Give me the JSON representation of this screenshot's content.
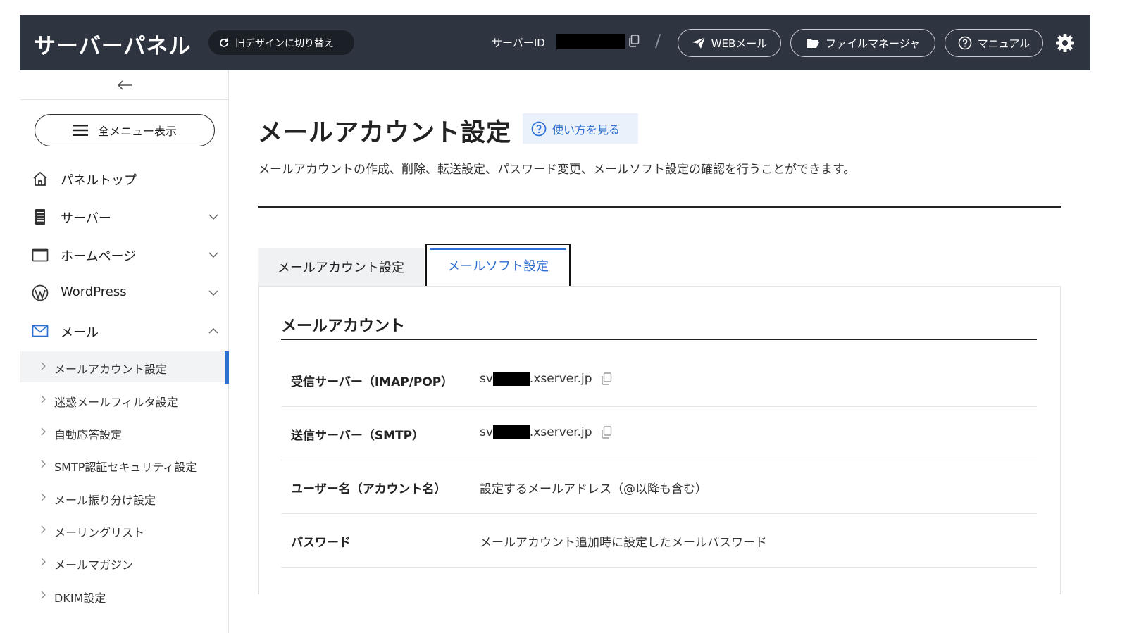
{
  "header": {
    "logo": "サーバーパネル",
    "old_design_label": "旧デザインに切り替え",
    "server_id_label": "サーバーID",
    "separator": "/",
    "webmail_label": "WEBメール",
    "file_manager_label": "ファイルマネージャ",
    "manual_label": "マニュアル"
  },
  "sidebar": {
    "all_menu_label": "全メニュー表示",
    "nav": [
      {
        "label": "パネルトップ",
        "icon": "home-icon"
      },
      {
        "label": "サーバー",
        "icon": "server-icon"
      },
      {
        "label": "ホームページ",
        "icon": "browser-window-icon"
      },
      {
        "label": "WordPress",
        "icon": "wordpress-icon"
      },
      {
        "label": "メール",
        "icon": "mail-icon"
      }
    ],
    "mail_submenu": [
      {
        "label": "メールアカウント設定",
        "active": true
      },
      {
        "label": "迷惑メールフィルタ設定"
      },
      {
        "label": "自動応答設定"
      },
      {
        "label": "SMTP認証セキュリティ設定"
      },
      {
        "label": "メール振り分け設定"
      },
      {
        "label": "メーリングリスト"
      },
      {
        "label": "メールマガジン"
      },
      {
        "label": "DKIM設定"
      }
    ]
  },
  "main": {
    "title": "メールアカウント設定",
    "howto_label": "使い方を見る",
    "description": "メールアカウントの作成、削除、転送設定、パスワード変更、メールソフト設定の確認を行うことができます。",
    "tabs": [
      {
        "label": "メールアカウント設定",
        "active": false
      },
      {
        "label": "メールソフト設定",
        "active": true
      }
    ],
    "panel": {
      "heading": "メールアカウント",
      "rows": [
        {
          "key": "受信サーバー（IMAP/POP）",
          "value_prefix": "sv",
          "value_suffix": ".xserver.jp"
        },
        {
          "key": "送信サーバー（SMTP）",
          "value_prefix": "sv",
          "value_suffix": ".xserver.jp"
        },
        {
          "key": "ユーザー名（アカウント名）",
          "value": "設定するメールアドレス（@以降も含む）"
        },
        {
          "key": "パスワード",
          "value": "メールアカウント追加時に設定したメールパスワード"
        }
      ]
    }
  },
  "colors": {
    "header_bg": "#2e3440",
    "accent": "#2d6fd1",
    "howto_bg": "#eaf1fb"
  }
}
